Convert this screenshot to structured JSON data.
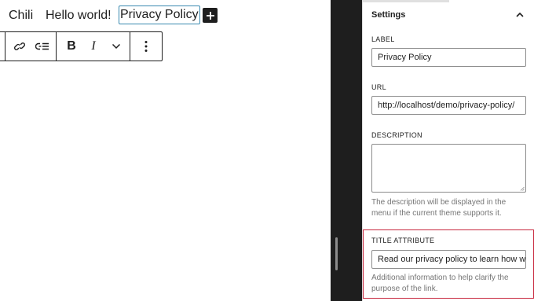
{
  "nav": {
    "items": [
      "Chili",
      "Hello world!",
      "Privacy Policy"
    ],
    "add_icon": "plus-icon"
  },
  "toolbar": {
    "icons": [
      "link-icon",
      "submenu-icon",
      "bold-icon",
      "italic-icon",
      "chevron-down-icon",
      "more-vertical-icon"
    ],
    "bold_glyph": "B",
    "italic_glyph": "I"
  },
  "sidebar": {
    "title": "Settings",
    "collapse_icon": "chevron-up-icon",
    "label_field": {
      "label": "LABEL",
      "value": "Privacy Policy"
    },
    "url_field": {
      "label": "URL",
      "value": "http://localhost/demo/privacy-policy/"
    },
    "description_field": {
      "label": "DESCRIPTION",
      "value": "",
      "help": "The description will be displayed in the menu if the current theme supports it."
    },
    "title_attribute_field": {
      "label": "TITLE ATTRIBUTE",
      "value": "Read our privacy policy to learn how w",
      "help": "Additional information to help clarify the purpose of the link."
    },
    "highlight_color": "#c8283e"
  }
}
